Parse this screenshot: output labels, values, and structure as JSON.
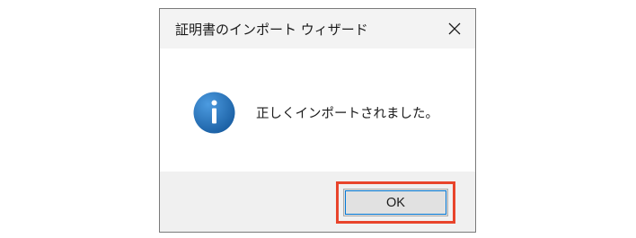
{
  "dialog": {
    "title": "証明書のインポート ウィザード",
    "message": "正しくインポートされました。",
    "ok_label": "OK",
    "icon": "info-icon",
    "close_icon": "close-icon",
    "colors": {
      "icon_blue": "#1f6fb5",
      "highlight": "#e8442b",
      "focus": "#0078d7"
    }
  }
}
